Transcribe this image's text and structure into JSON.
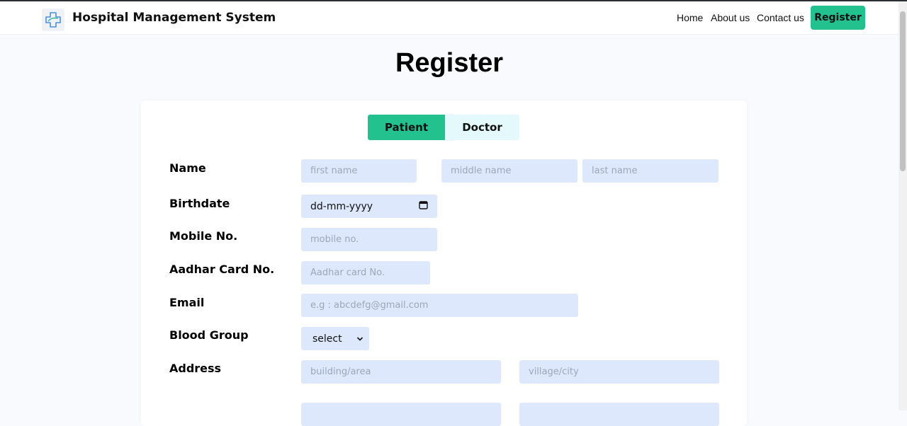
{
  "navbar": {
    "brand_title": "Hospital Management System",
    "links": [
      "Home",
      "About us",
      "Contact us"
    ],
    "register_label": "Register"
  },
  "page": {
    "title": "Register"
  },
  "tabs": {
    "patient": "Patient",
    "doctor": "Doctor",
    "active": "Patient"
  },
  "form": {
    "labels": {
      "name": "Name",
      "birthdate": "Birthdate",
      "mobile": "Mobile No.",
      "aadhar": "Aadhar Card No.",
      "email": "Email",
      "blood_group": "Blood Group",
      "address": "Address"
    },
    "placeholders": {
      "first_name": "first name",
      "middle_name": "middle name",
      "last_name": "last name",
      "mobile": "mobile no.",
      "aadhar": "Aadhar card No.",
      "email": "e.g : abcdefg@gmail.com",
      "building": "building/area",
      "village": "village/city"
    },
    "birthdate_value": "dd-mm-yyyy",
    "blood_group_value": "select"
  },
  "colors": {
    "accent": "#22c18e",
    "tab_inactive": "#e3f9fb",
    "input_bg": "#dde8fc"
  }
}
